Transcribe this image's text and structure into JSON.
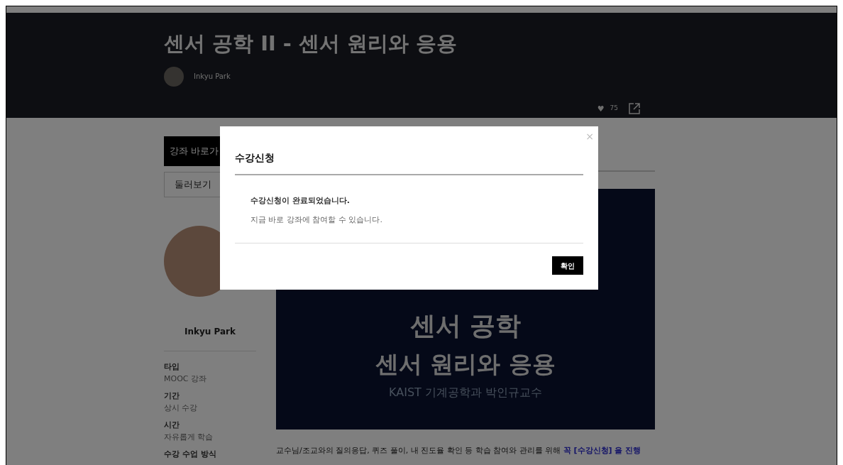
{
  "header": {
    "title": "센서 공학 II - 센서 원리와 응용",
    "author": "Inkyu Park",
    "heart": "♥",
    "likes": "75"
  },
  "sidebar": {
    "buttons": [
      {
        "label": "강좌 바로가",
        "kind": "primary"
      },
      {
        "label": "둘러보기",
        "kind": "outline"
      }
    ],
    "profile_name": "Inkyu Park",
    "info": [
      {
        "label": "타입",
        "value": "MOOC 강좌"
      },
      {
        "label": "기간",
        "value": "상시 수강"
      },
      {
        "label": "시간",
        "value": "자유롭게 학습"
      },
      {
        "label": "수강 수업 방식"
      }
    ]
  },
  "hero": {
    "title": "센서 공학",
    "subtitle": "센서 원리와 응용",
    "caption": "KAIST 기계공학과 박인규교수"
  },
  "paragraph": {
    "text": "교수님/조교와의 질의응답, 퀴즈 풀이, 내 진도율 확인 등 학습 참여와 관리를 위해",
    "link": "꼭 [수강신청] 을 진행"
  },
  "modal": {
    "title": "수강신청",
    "close": "×",
    "message": "수강신청이 완료되었습니다.",
    "subtext": "지금 바로 강좌에 참여할 수 있습니다.",
    "confirm": "확인"
  }
}
